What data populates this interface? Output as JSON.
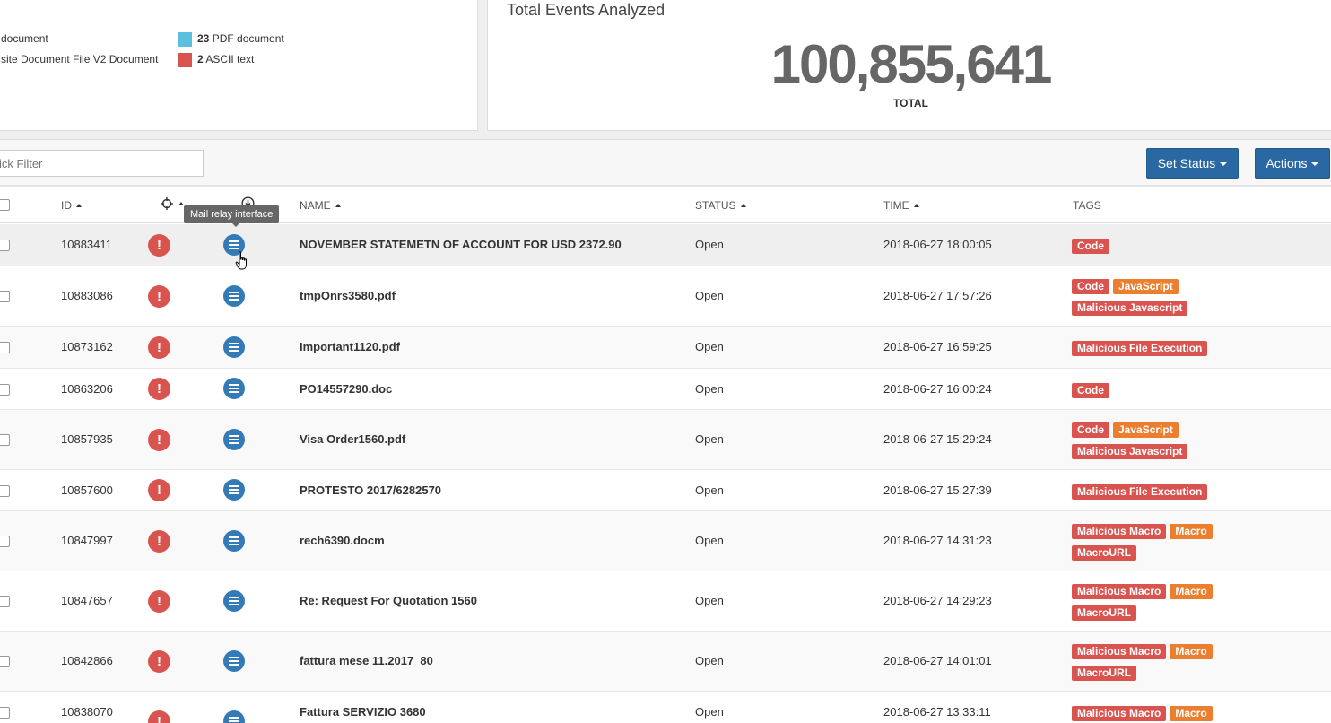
{
  "file_types_legend": [
    {
      "count": "",
      "label": "document",
      "color": "#5bc0de"
    },
    {
      "count": "",
      "label": "site Document File V2 Document",
      "color": "#d9534f"
    },
    {
      "count": "23",
      "label": "PDF document",
      "color": "#5bc0de"
    },
    {
      "count": "2",
      "label": "ASCII text",
      "color": "#d9534f"
    }
  ],
  "events": {
    "title": "Total Events Analyzed",
    "total": "100,855,641",
    "total_label": "TOTAL"
  },
  "toolbar": {
    "quick_filter_placeholder": "ick Filter",
    "set_status_label": "Set Status",
    "actions_label": "Actions"
  },
  "columns": {
    "id": "ID",
    "name": "NAME",
    "status": "STATUS",
    "time": "TIME",
    "tags": "TAGS"
  },
  "tooltip": "Mail relay interface",
  "colors": {
    "primary": "#2968a3",
    "danger": "#d9534f",
    "warning": "#ec7f2f",
    "info": "#337ab7"
  },
  "rows": [
    {
      "id": "10883411",
      "name": "NOVEMBER STATEMETN OF ACCOUNT FOR USD 2372.90",
      "status": "Open",
      "time": "2018-06-27 18:00:05",
      "tags": [
        {
          "label": "Code",
          "color": "red"
        }
      ]
    },
    {
      "id": "10883086",
      "name": "tmpOnrs3580.pdf",
      "status": "Open",
      "time": "2018-06-27 17:57:26",
      "tags": [
        {
          "label": "Code",
          "color": "red"
        },
        {
          "label": "JavaScript",
          "color": "orange"
        },
        {
          "label": "Malicious Javascript",
          "color": "red"
        }
      ]
    },
    {
      "id": "10873162",
      "name": "Important1120.pdf",
      "status": "Open",
      "time": "2018-06-27 16:59:25",
      "tags": [
        {
          "label": "Malicious File Execution",
          "color": "red"
        }
      ]
    },
    {
      "id": "10863206",
      "name": "PO14557290.doc",
      "status": "Open",
      "time": "2018-06-27 16:00:24",
      "tags": [
        {
          "label": "Code",
          "color": "red"
        }
      ]
    },
    {
      "id": "10857935",
      "name": "Visa Order1560.pdf",
      "status": "Open",
      "time": "2018-06-27 15:29:24",
      "tags": [
        {
          "label": "Code",
          "color": "red"
        },
        {
          "label": "JavaScript",
          "color": "orange"
        },
        {
          "label": "Malicious Javascript",
          "color": "red"
        }
      ]
    },
    {
      "id": "10857600",
      "name": "PROTESTO 2017/6282570",
      "status": "Open",
      "time": "2018-06-27 15:27:39",
      "tags": [
        {
          "label": "Malicious File Execution",
          "color": "red"
        }
      ]
    },
    {
      "id": "10847997",
      "name": "rech6390.docm",
      "status": "Open",
      "time": "2018-06-27 14:31:23",
      "tags": [
        {
          "label": "Malicious Macro",
          "color": "red"
        },
        {
          "label": "Macro",
          "color": "orange"
        },
        {
          "label": "MacroURL",
          "color": "red"
        }
      ]
    },
    {
      "id": "10847657",
      "name": "Re: Request For Quotation 1560",
      "status": "Open",
      "time": "2018-06-27 14:29:23",
      "tags": [
        {
          "label": "Malicious Macro",
          "color": "red"
        },
        {
          "label": "Macro",
          "color": "orange"
        },
        {
          "label": "MacroURL",
          "color": "red"
        }
      ]
    },
    {
      "id": "10842866",
      "name": "fattura mese 11.2017_80",
      "status": "Open",
      "time": "2018-06-27 14:01:01",
      "tags": [
        {
          "label": "Malicious Macro",
          "color": "red"
        },
        {
          "label": "Macro",
          "color": "orange"
        },
        {
          "label": "MacroURL",
          "color": "red"
        }
      ]
    },
    {
      "id": "10838070",
      "name": "Fattura SERVIZIO 3680",
      "status": "Open",
      "time": "2018-06-27 13:33:11",
      "tags": [
        {
          "label": "Malicious Macro",
          "color": "red"
        },
        {
          "label": "Macro",
          "color": "orange"
        }
      ]
    }
  ]
}
